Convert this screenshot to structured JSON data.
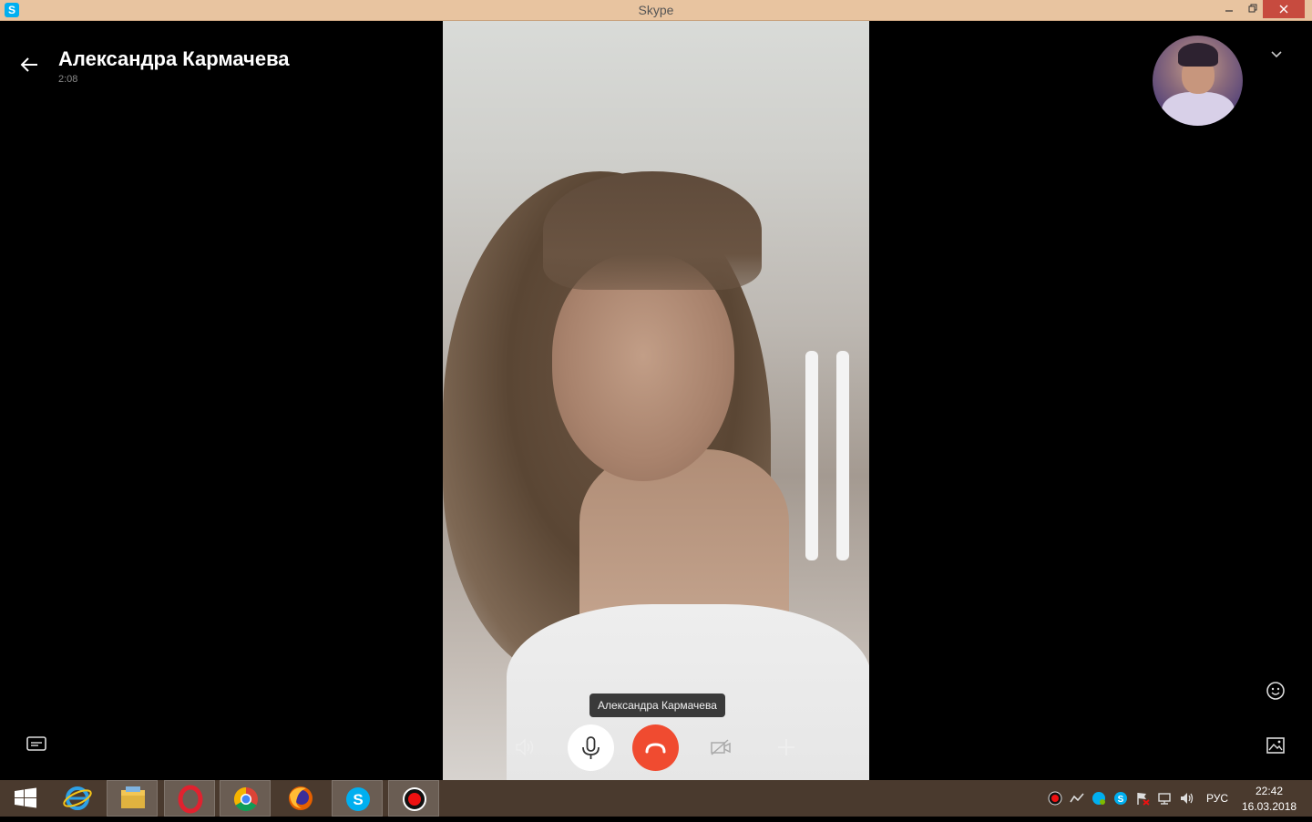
{
  "window": {
    "title": "Skype",
    "app_icon": "skype-icon",
    "controls": [
      "minimize-icon",
      "maximize-icon",
      "close-icon"
    ]
  },
  "call": {
    "contact_name": "Александра Кармачева",
    "duration": "2:08",
    "video_label": "Александра Кармачева",
    "controls": [
      {
        "name": "speaker",
        "icon": "speaker-icon"
      },
      {
        "name": "mute",
        "icon": "microphone-icon"
      },
      {
        "name": "end-call",
        "icon": "hang-up-icon",
        "color": "#f04b30"
      },
      {
        "name": "video",
        "icon": "video-off-icon"
      },
      {
        "name": "add",
        "icon": "plus-icon"
      }
    ],
    "side_controls": [
      "chat-icon",
      "emoji-icon",
      "gallery-icon"
    ]
  },
  "taskbar": {
    "apps": [
      "windows-start-icon",
      "internet-explorer-icon",
      "file-explorer-icon",
      "opera-icon",
      "chrome-icon",
      "firefox-icon",
      "skype-icon",
      "recorder-icon"
    ],
    "tray_icons": [
      "record-icon",
      "network-activity-icon",
      "skype-status-icon",
      "skype-icon",
      "flag-icon",
      "network-icon",
      "volume-icon"
    ],
    "language": "РУС",
    "time": "22:42",
    "date": "16.03.2018"
  },
  "colors": {
    "titlebar": "#e8c4a0",
    "end_call": "#f04b30",
    "taskbar": "#4a3a2e"
  }
}
